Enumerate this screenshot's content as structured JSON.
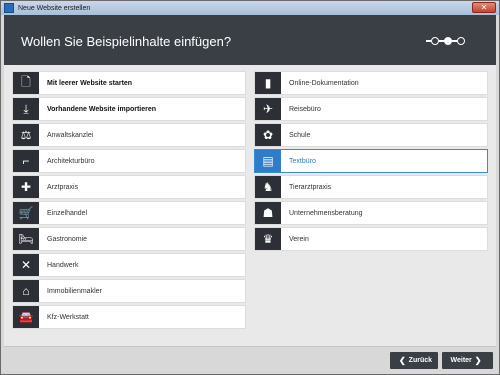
{
  "window": {
    "title": "Neue Website erstellen",
    "close_glyph": "✕"
  },
  "header": {
    "heading": "Wollen Sie Beispielinhalte einfügen?",
    "steps_total": 3,
    "step_current": 1
  },
  "left_items": [
    {
      "label": "Mit leerer Website starten",
      "icon": "blank-page-icon",
      "glyph": "🗋",
      "bold": true
    },
    {
      "label": "Vorhandene Website importieren",
      "icon": "import-icon",
      "glyph": "⤓",
      "bold": true
    },
    {
      "label": "Anwaltskanzlei",
      "icon": "gavel-icon",
      "glyph": "⚖"
    },
    {
      "label": "Architekturbüro",
      "icon": "ruler-icon",
      "glyph": "⌐"
    },
    {
      "label": "Arztpraxis",
      "icon": "medical-cross-icon",
      "glyph": "✚"
    },
    {
      "label": "Einzelhandel",
      "icon": "shopping-cart-icon",
      "glyph": "🛒"
    },
    {
      "label": "Gastronomie",
      "icon": "bed-icon",
      "glyph": "🛏"
    },
    {
      "label": "Handwerk",
      "icon": "tools-icon",
      "glyph": "✕"
    },
    {
      "label": "Immobilienmakler",
      "icon": "house-icon",
      "glyph": "⌂"
    },
    {
      "label": "Kfz-Werkstatt",
      "icon": "car-icon",
      "glyph": "🚘"
    }
  ],
  "right_items": [
    {
      "label": "Online-Dokumentation",
      "icon": "book-icon",
      "glyph": "▮"
    },
    {
      "label": "Reisebüro",
      "icon": "airplane-icon",
      "glyph": "✈"
    },
    {
      "label": "Schule",
      "icon": "school-icon",
      "glyph": "✿"
    },
    {
      "label": "Textbüro",
      "icon": "document-text-icon",
      "glyph": "▤",
      "selected": true
    },
    {
      "label": "Tierarztpraxis",
      "icon": "vet-icon",
      "glyph": "♞"
    },
    {
      "label": "Unternehmensberatung",
      "icon": "consultant-icon",
      "glyph": "☗"
    },
    {
      "label": "Verein",
      "icon": "trophy-icon",
      "glyph": "♛"
    }
  ],
  "footer": {
    "back_label": "Zurück",
    "next_label": "Weiter",
    "back_glyph": "❮",
    "next_glyph": "❯"
  }
}
